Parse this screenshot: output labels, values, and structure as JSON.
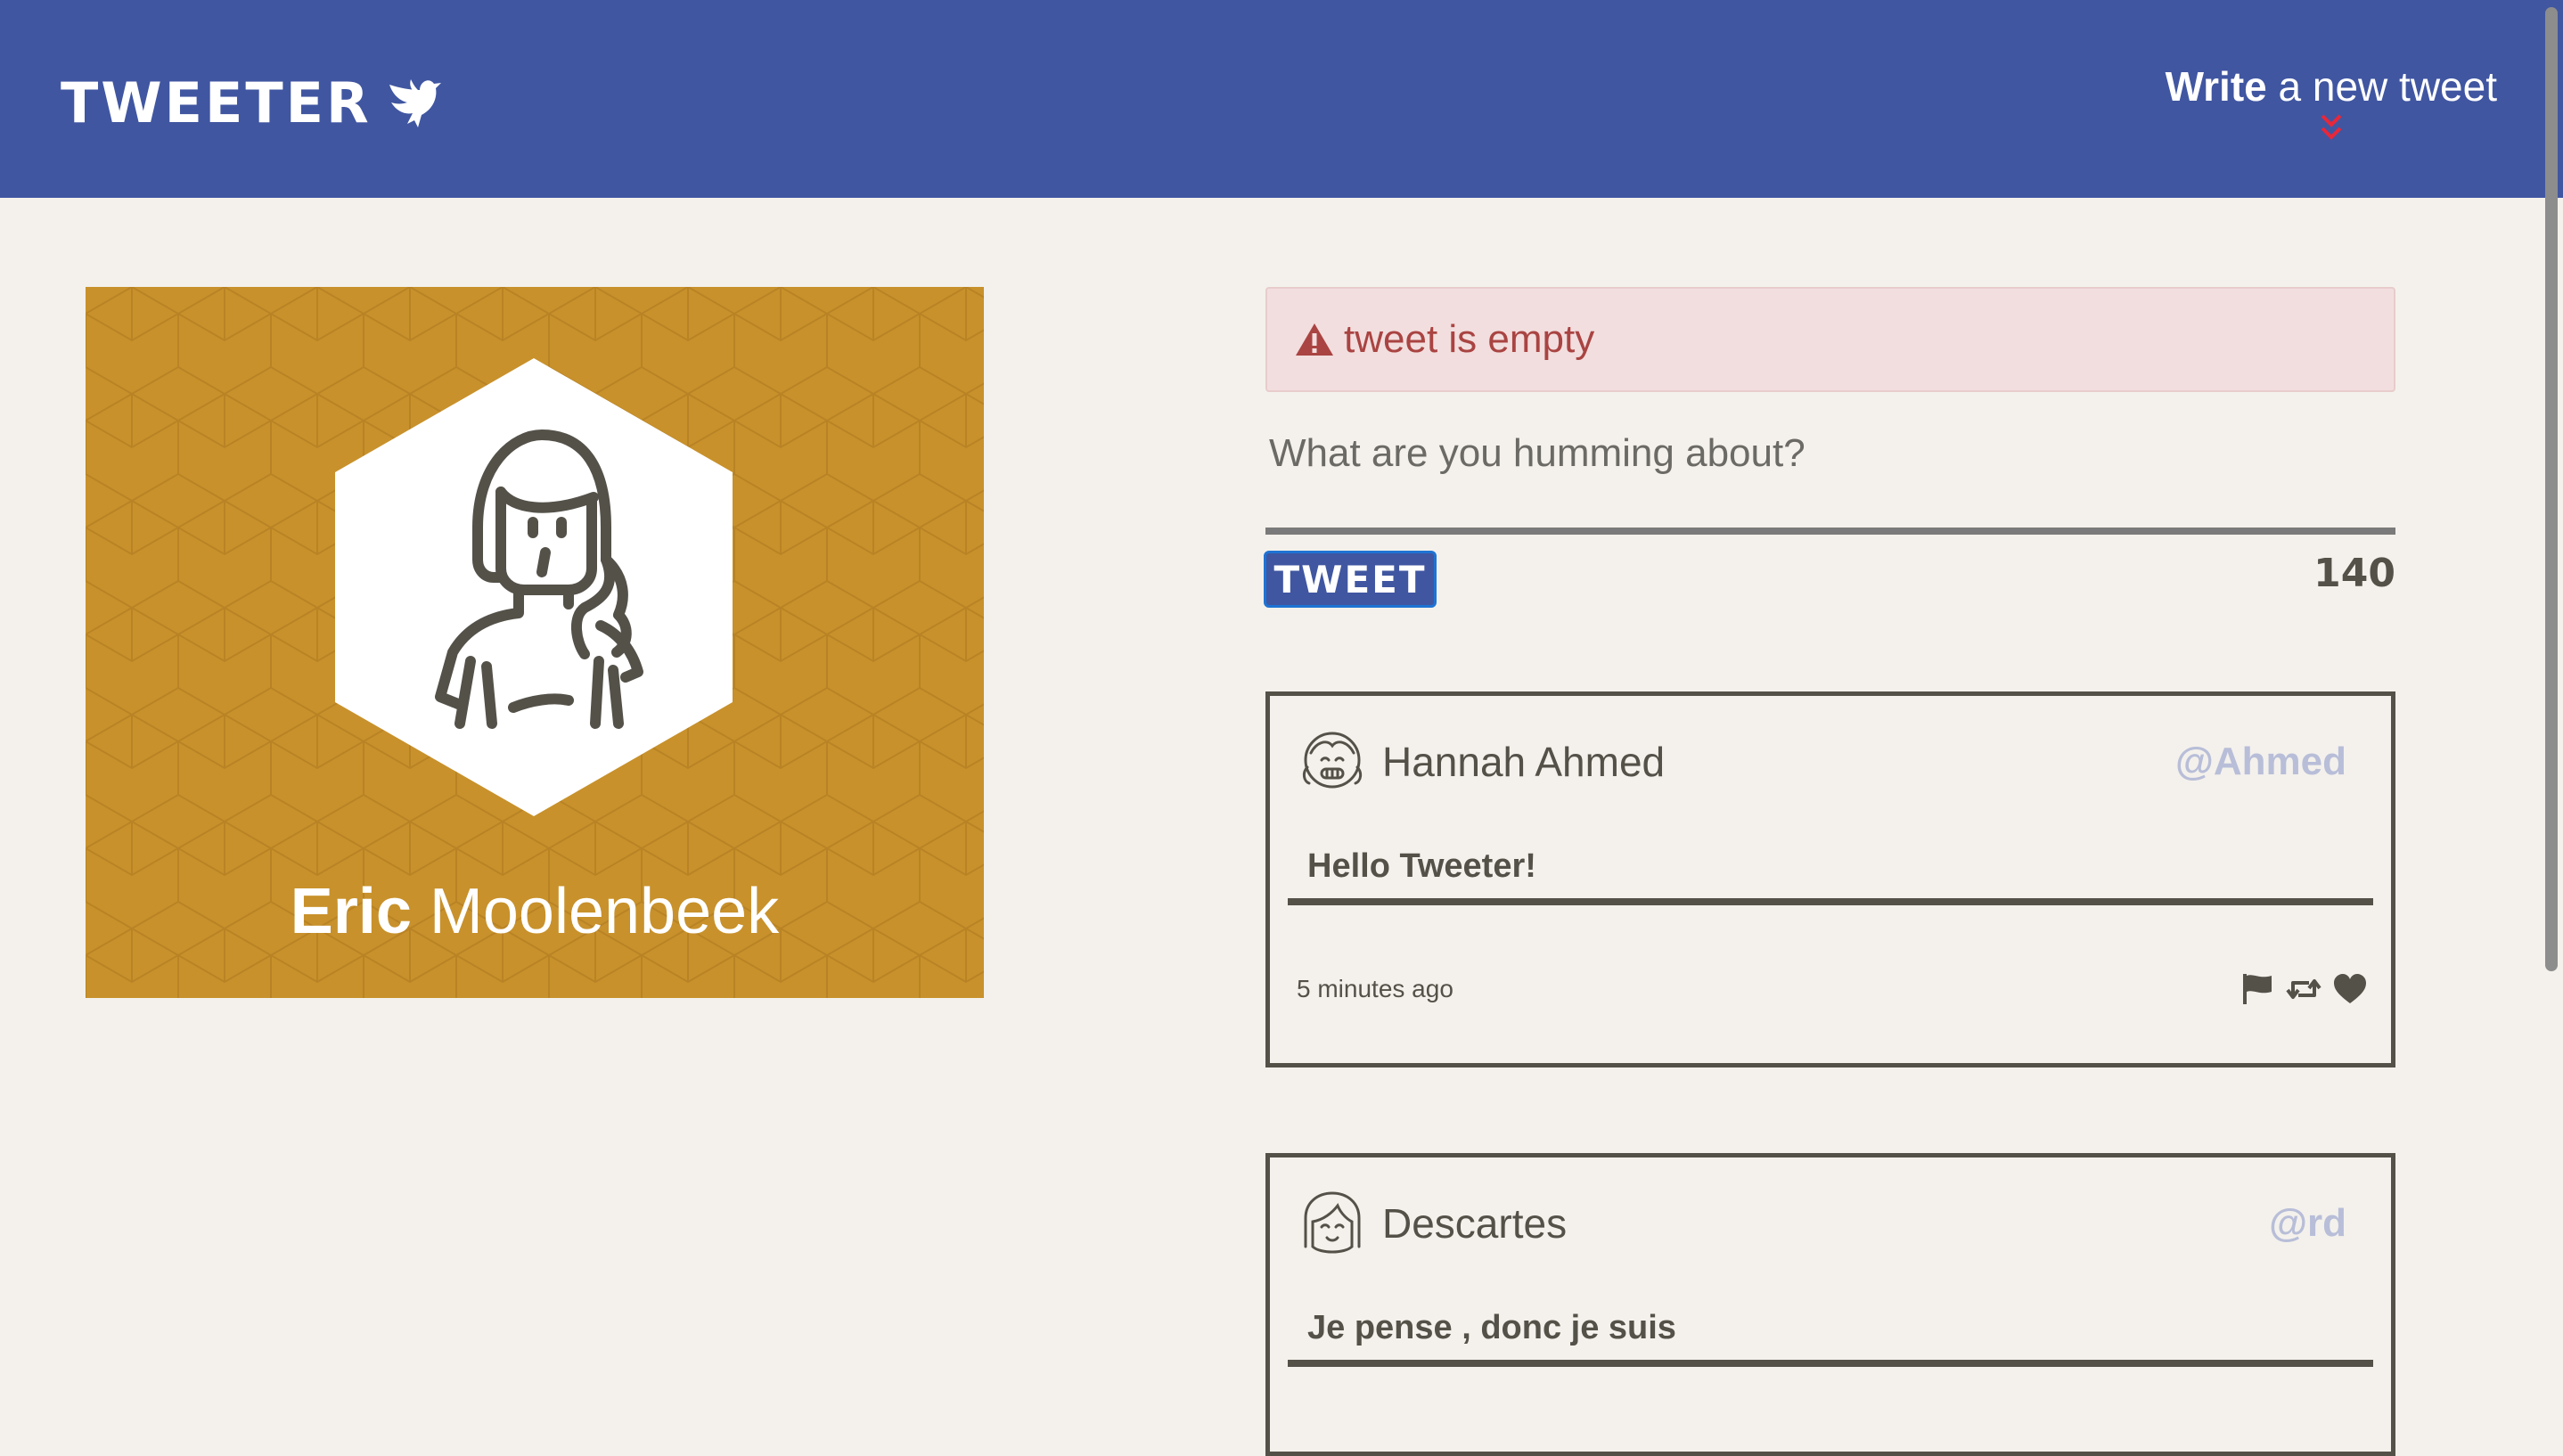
{
  "nav": {
    "brand": "TWEETER",
    "brand_icon": "dove-icon",
    "compose_strong": "Write",
    "compose_rest": "a new tweet",
    "compose_icon": "double-chevron-down-icon"
  },
  "profile": {
    "first_name": "Eric",
    "last_name": "Moolenbeek",
    "avatar_icon": "woman-avatar-icon",
    "background_color": "#c8912b"
  },
  "compose": {
    "error": "tweet is empty",
    "error_icon": "warning-icon",
    "placeholder": "What are you humming about?",
    "submit_label": "TWEET",
    "counter": "140"
  },
  "tweets": [
    {
      "user": "Hannah Ahmed",
      "handle": "@Ahmed",
      "text": "Hello Tweeter!",
      "time": "5 minutes ago",
      "avatar_icon": "girl-avatar-icon"
    },
    {
      "user": "Descartes",
      "handle": "@rd",
      "text": "Je pense , donc je suis",
      "time": "",
      "avatar_icon": "girl-avatar-icon"
    }
  ],
  "colors": {
    "nav": "#4056a1",
    "page": "#f4f1ec",
    "text": "#545149",
    "handle": "#b8bed8",
    "alert_bg": "#f2dede",
    "alert_text": "#a94442",
    "accent_red": "#e8273a"
  }
}
